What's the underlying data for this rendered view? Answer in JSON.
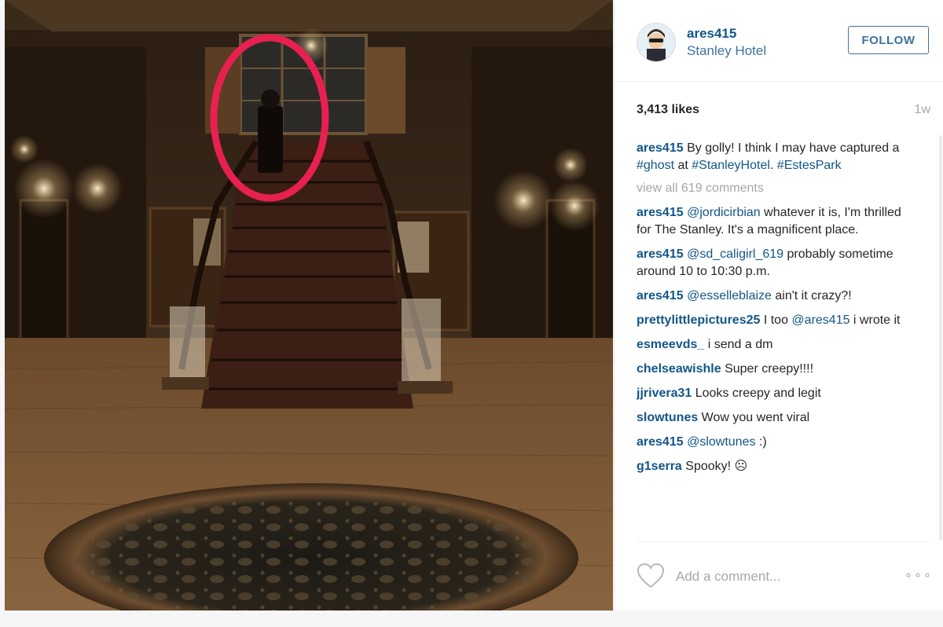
{
  "post": {
    "username": "ares415",
    "location": "Stanley Hotel",
    "follow_label": "FOLLOW",
    "likes": "3,413 likes",
    "age": "1w",
    "caption": {
      "user": "ares415",
      "text_1": "By golly! I think I may have captured a ",
      "tag_1": "#ghost",
      "text_2": " at ",
      "tag_2": "#StanleyHotel",
      "text_3": ". ",
      "tag_3": "#EstesPark"
    },
    "view_all": "view all 619 comments",
    "comments": [
      {
        "user": "ares415",
        "mention": "@jordicirbian",
        "text": " whatever it is, I'm thrilled for The Stanley. It's a magnificent place."
      },
      {
        "user": "ares415",
        "mention": "@sd_caligirl_619",
        "text": " probably sometime around 10 to 10:30 p.m."
      },
      {
        "user": "ares415",
        "mention": "@esselleblaize",
        "text": " ain't it crazy?!"
      },
      {
        "user": "prettylittlepictures25",
        "text_pre": " I too ",
        "mention": "@ares415",
        "text": " i wrote it"
      },
      {
        "user": "esmeevds_",
        "text": " i send a dm"
      },
      {
        "user": "chelseawishle",
        "text": " Super creepy!!!!"
      },
      {
        "user": "jjrivera31",
        "text": " Looks creepy and legit"
      },
      {
        "user": "slowtunes",
        "text": " Wow you went viral"
      },
      {
        "user": "ares415",
        "mention": "@slowtunes",
        "text": " :)"
      },
      {
        "user": "g1serra",
        "text": " Spooky! ☹"
      }
    ],
    "add_comment_placeholder": "Add a comment...",
    "more_label": "∘∘∘"
  },
  "colors": {
    "link": "#125688",
    "location": "#3f729b",
    "muted": "#a5a7aa",
    "highlight_circle": "#e8204f"
  },
  "icons": [
    "heart-icon",
    "more-options-icon"
  ]
}
